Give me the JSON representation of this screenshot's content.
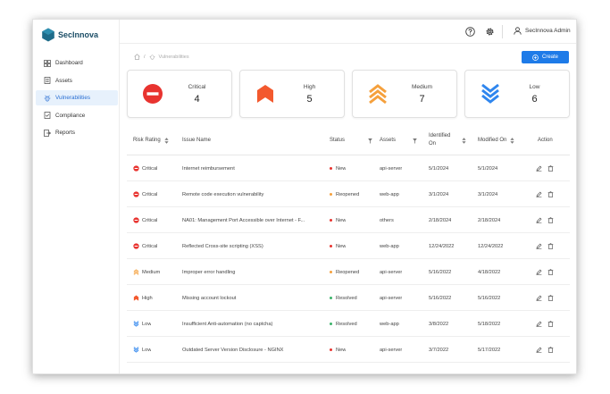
{
  "app": {
    "brand": "SecInnova",
    "user": "SecInnova Admin"
  },
  "sidebar": {
    "items": [
      {
        "label": "Dashboard",
        "icon": "dashboard-icon",
        "active": false
      },
      {
        "label": "Assets",
        "icon": "assets-icon",
        "active": false
      },
      {
        "label": "Vulnerabilities",
        "icon": "bug-icon",
        "active": true
      },
      {
        "label": "Compliance",
        "icon": "compliance-icon",
        "active": false
      },
      {
        "label": "Reports",
        "icon": "reports-icon",
        "active": false
      }
    ]
  },
  "breadcrumb": {
    "sep": "/",
    "current": "Vulnerabilities"
  },
  "toolbar": {
    "create_label": "Create"
  },
  "summary": [
    {
      "label": "Critical",
      "value": "4",
      "icon": "critical-icon",
      "color": "#e8332f"
    },
    {
      "label": "High",
      "value": "5",
      "icon": "high-icon",
      "color": "#f3592e"
    },
    {
      "label": "Medium",
      "value": "7",
      "icon": "medium-icon",
      "color": "#f5a03c"
    },
    {
      "label": "Low",
      "value": "6",
      "icon": "low-icon",
      "color": "#2f86ee"
    }
  ],
  "table": {
    "headers": {
      "risk": "Risk Rating",
      "issue": "Issue Name",
      "status": "Status",
      "assets": "Assets",
      "identified_1": "Identified",
      "identified_2": "On",
      "modified": "Modified On",
      "action": "Action"
    },
    "rows": [
      {
        "risk": "Critical",
        "issue": "Internet reimbursement",
        "status": "New",
        "asset": "api-server",
        "identified": "5/1/2024",
        "modified": "5/1/2024"
      },
      {
        "risk": "Critical",
        "issue": "Remote code execution vulnerability",
        "status": "Reopened",
        "asset": "web-app",
        "identified": "3/1/2024",
        "modified": "3/1/2024"
      },
      {
        "risk": "Critical",
        "issue": "NA01: Management Port Accessible over Internet - F...",
        "status": "New",
        "asset": "others",
        "identified": "2/18/2024",
        "modified": "2/18/2024"
      },
      {
        "risk": "Critical",
        "issue": "Reflected Cross-site scripting (XSS)",
        "status": "New",
        "asset": "web-app",
        "identified": "12/24/2022",
        "modified": "12/24/2022"
      },
      {
        "risk": "Medium",
        "issue": "Improper error handling",
        "status": "Reopened",
        "asset": "api-server",
        "identified": "5/16/2022",
        "modified": "4/18/2022"
      },
      {
        "risk": "High",
        "issue": "Missing account lockout",
        "status": "Resolved",
        "asset": "api-server",
        "identified": "5/16/2022",
        "modified": "5/16/2022"
      },
      {
        "risk": "Low",
        "issue": "Insufficient Anti-automation (no captcha)",
        "status": "Resolved",
        "asset": "web-app",
        "identified": "3/8/2022",
        "modified": "5/18/2022"
      },
      {
        "risk": "Low",
        "issue": "Outdated Server Version Disclosure - NGINX",
        "status": "New",
        "asset": "api-server",
        "identified": "3/7/2022",
        "modified": "5/17/2022"
      }
    ]
  },
  "colors": {
    "accent": "#1e7be8",
    "status_new": "#e8332f",
    "status_reopened": "#f5a03c",
    "status_resolved": "#3bb36a"
  }
}
